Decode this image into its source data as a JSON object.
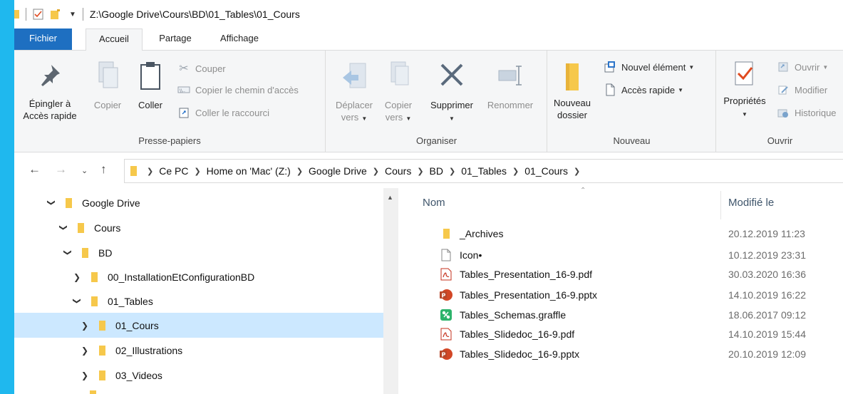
{
  "titlebar": {
    "path": "Z:\\Google Drive\\Cours\\BD\\01_Tables\\01_Cours"
  },
  "tabs": {
    "file": "Fichier",
    "home": "Accueil",
    "share": "Partage",
    "view": "Affichage"
  },
  "ribbon": {
    "clipboard": {
      "pin_line1": "Épingler à",
      "pin_line2": "Accès rapide",
      "copy": "Copier",
      "paste": "Coller",
      "cut": "Couper",
      "copy_path": "Copier le chemin d'accès",
      "paste_shortcut": "Coller le raccourci",
      "label": "Presse-papiers"
    },
    "organize": {
      "move_line1": "Déplacer",
      "move_line2": "vers",
      "copy_line1": "Copier",
      "copy_line2": "vers",
      "delete": "Supprimer",
      "rename": "Renommer",
      "label": "Organiser"
    },
    "new": {
      "folder_line1": "Nouveau",
      "folder_line2": "dossier",
      "new_item": "Nouvel élément",
      "easy_access": "Accès rapide",
      "label": "Nouveau"
    },
    "open": {
      "properties": "Propriétés",
      "open": "Ouvrir",
      "edit": "Modifier",
      "history": "Historique",
      "label": "Ouvrir"
    }
  },
  "breadcrumb": [
    "Ce PC",
    "Home on 'Mac' (Z:)",
    "Google Drive",
    "Cours",
    "BD",
    "01_Tables",
    "01_Cours"
  ],
  "tree": [
    {
      "label": "Google Drive",
      "expanded": true
    },
    {
      "label": "Cours",
      "expanded": true
    },
    {
      "label": "BD",
      "expanded": true
    },
    {
      "label": "00_InstallationEtConfigurationBD",
      "expanded": false
    },
    {
      "label": "01_Tables",
      "expanded": true
    },
    {
      "label": "01_Cours",
      "expanded": false,
      "selected": true
    },
    {
      "label": "02_Illustrations",
      "expanded": false
    },
    {
      "label": "03_Videos",
      "expanded": false
    }
  ],
  "filelist": {
    "col_name": "Nom",
    "col_modified": "Modifié le",
    "files": [
      {
        "name": "_Archives",
        "date": "20.12.2019 11:23",
        "icon": "folder-icon"
      },
      {
        "name": "Icon•",
        "date": "10.12.2019 23:31",
        "icon": "blank-file-icon"
      },
      {
        "name": "Tables_Presentation_16-9.pdf",
        "date": "30.03.2020 16:36",
        "icon": "pdf-icon"
      },
      {
        "name": "Tables_Presentation_16-9.pptx",
        "date": "14.10.2019 16:22",
        "icon": "powerpoint-icon"
      },
      {
        "name": "Tables_Schemas.graffle",
        "date": "18.06.2017 09:12",
        "icon": "graffle-icon"
      },
      {
        "name": "Tables_Slidedoc_16-9.pdf",
        "date": "14.10.2019 15:44",
        "icon": "pdf-icon"
      },
      {
        "name": "Tables_Slidedoc_16-9.pptx",
        "date": "20.10.2019 12:09",
        "icon": "powerpoint-icon"
      }
    ]
  },
  "colors": {
    "accent": "#1e6fc1",
    "background": "#1fb8ee",
    "selection": "#cce8ff",
    "folder": "#f6c84b"
  }
}
